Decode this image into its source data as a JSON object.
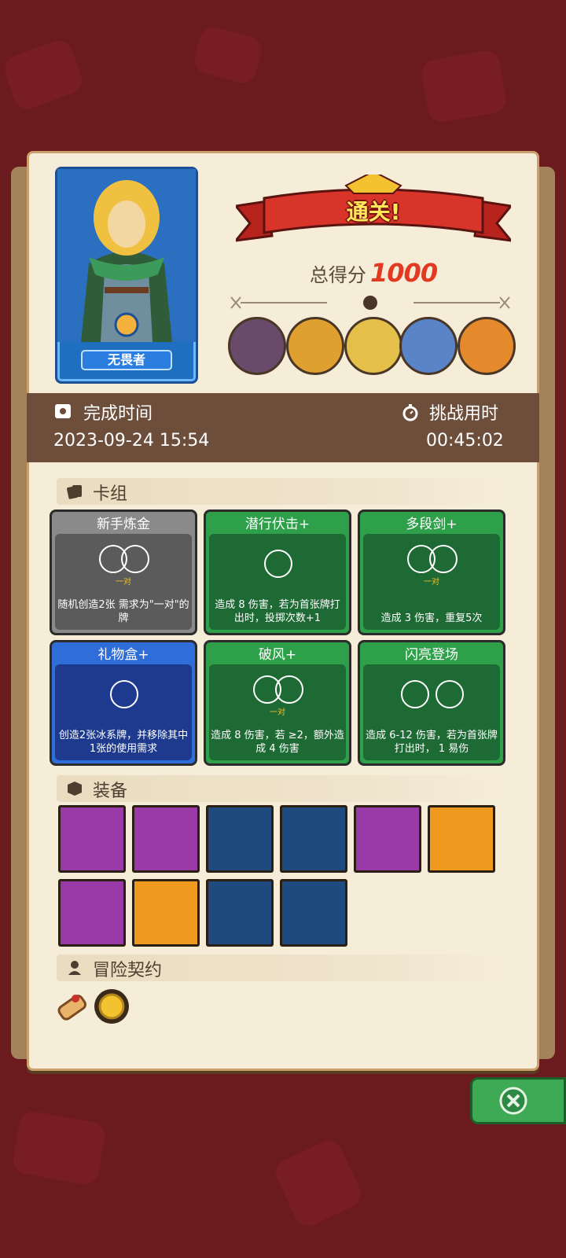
{
  "hero": {
    "name": "无畏者"
  },
  "banner": {
    "title": "通关!"
  },
  "score": {
    "label": "总得分",
    "value": "1000"
  },
  "completion": {
    "label": "完成时间",
    "value": "2023-09-24 15:54"
  },
  "challenge": {
    "label": "挑战用时",
    "value": "00:45:02"
  },
  "sections": {
    "deck": "卡组",
    "equipment": "装备",
    "contracts": "冒险契约"
  },
  "deck_cards": [
    {
      "title": "新手炼金",
      "color": "gray",
      "sub": "一对",
      "desc": "随机创造2张 需求为\"一对\"的牌"
    },
    {
      "title": "潜行伏击+",
      "color": "green",
      "sub": "",
      "desc": "造成 8 伤害，若为首张牌打出时，投掷次数+1"
    },
    {
      "title": "多段剑+",
      "color": "green",
      "sub": "一对",
      "desc": "造成 3 伤害，重复5次"
    },
    {
      "title": "礼物盒+",
      "color": "blue",
      "sub": "",
      "desc": "创造2张冰系牌，并移除其中1张的使用需求"
    },
    {
      "title": "破风+",
      "color": "green",
      "sub": "一对",
      "desc": "造成 8 伤害，若 ≥2，额外造成 4 伤害"
    },
    {
      "title": "闪亮登场",
      "color": "green",
      "sub": "",
      "desc": "造成 6-12 伤害，若为首张牌打出时， 1 易伤"
    }
  ],
  "colors": {
    "gray_body": "#5b5b5b",
    "gray_head": "#8a8a8a",
    "green_body": "#1e6a34",
    "green_head": "#2fa04a",
    "blue_body": "#1d3a8f",
    "blue_head": "#2f6ed8"
  },
  "equipment_icons": [
    "red-gem-necklace-icon",
    "blue-flame-icon",
    "scroll-icon",
    "magic-hat-dice-icon",
    "green-leaves-icon",
    "water-rune-icon",
    "banana-sword-icon",
    "turtle-shell-icon",
    "compass-star-icon",
    "golden-pot-icon"
  ],
  "contract_icons": [
    "scroll-contract-icon",
    "gold-coin-icon"
  ]
}
